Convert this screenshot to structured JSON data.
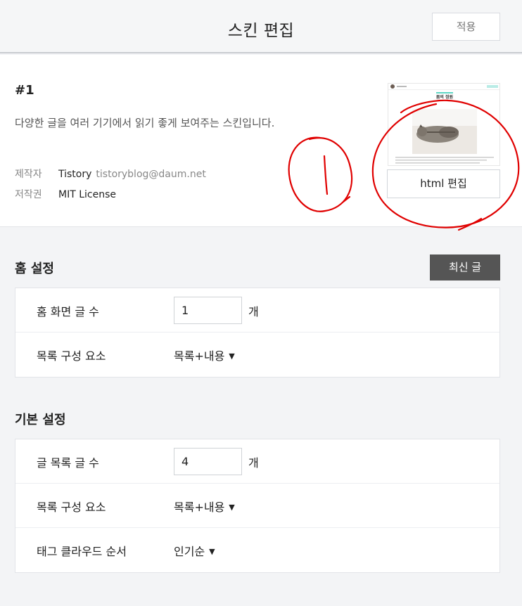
{
  "header": {
    "title": "스킨 편집",
    "apply_label": "적용"
  },
  "skin": {
    "number": "#1",
    "description": "다양한 글을 여러 기기에서 읽기 좋게 보여주는 스킨입니다.",
    "maker_label": "제작자",
    "maker_name": "Tistory",
    "maker_email": "tistoryblog@daum.net",
    "license_label": "저작권",
    "license_value": "MIT License",
    "thumbnail_title": "봄의 정원",
    "html_edit_label": "html 편집"
  },
  "annotation": {
    "mark": "1",
    "color": "#e00000"
  },
  "home_settings": {
    "title": "홈 설정",
    "latest_label": "최신 글",
    "rows": [
      {
        "label": "홈 화면 글 수",
        "value": "1",
        "unit": "개"
      },
      {
        "label": "목록 구성 요소",
        "selected": "목록+내용"
      }
    ]
  },
  "basic_settings": {
    "title": "기본 설정",
    "rows": [
      {
        "label": "글 목록 글 수",
        "value": "4",
        "unit": "개"
      },
      {
        "label": "목록 구성 요소",
        "selected": "목록+내용"
      },
      {
        "label": "태그 클라우드 순서",
        "selected": "인기순"
      }
    ]
  },
  "icons": {
    "dropdown": "caret-down-icon"
  }
}
